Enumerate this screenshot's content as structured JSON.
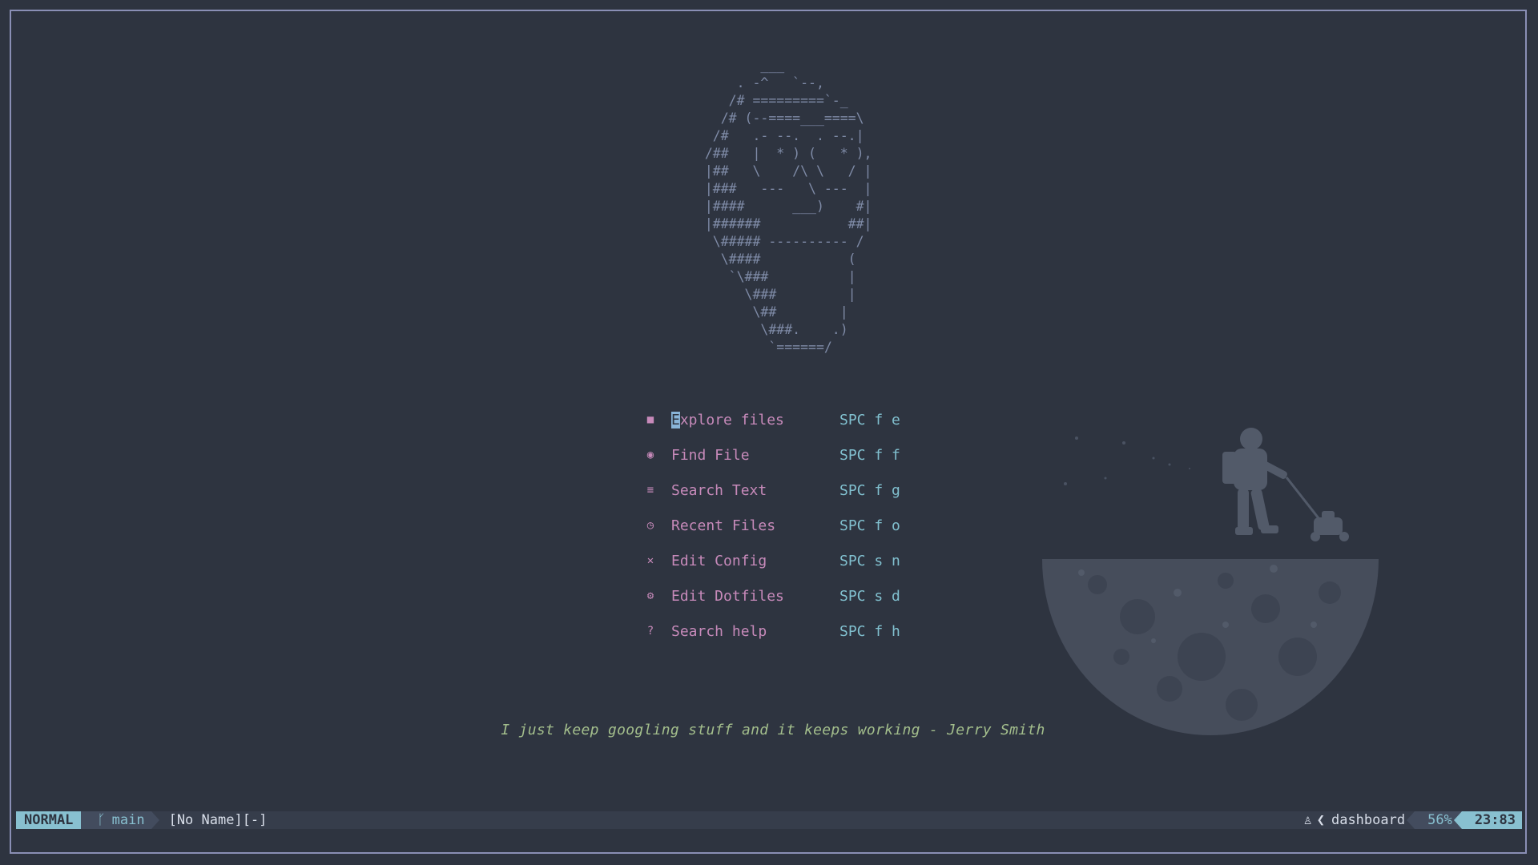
{
  "ascii_art": "         ___\n      . -^   `--,\n     /# =========`-_\n    /# (--====___====\\\n   /#   .- --.  . --.|\n  /##   |  * ) (   * ),\n  |##   \\    /\\ \\   / |\n  |###   ---   \\ ---  |\n  |####      ___)    #|\n  |######           ##|\n   \\##### ---------- /\n    \\####           (\n     `\\###          |\n       \\###         |\n        \\##        |\n         \\###.    .)\n          `======/",
  "menu": [
    {
      "icon": "file-icon",
      "glyph": "■",
      "first": "E",
      "rest": "xplore files",
      "key": "SPC f e"
    },
    {
      "icon": "find-file-icon",
      "glyph": "◉",
      "first": "",
      "rest": "Find File",
      "key": "SPC f f"
    },
    {
      "icon": "search-text-icon",
      "glyph": "≡",
      "first": "",
      "rest": "Search Text",
      "key": "SPC f g"
    },
    {
      "icon": "clock-icon",
      "glyph": "◷",
      "first": "",
      "rest": "Recent Files",
      "key": "SPC f o"
    },
    {
      "icon": "neovim-icon",
      "glyph": "✕",
      "first": "",
      "rest": "Edit Config",
      "key": "SPC s n"
    },
    {
      "icon": "gear-icon",
      "glyph": "⚙",
      "first": "",
      "rest": "Edit Dotfiles",
      "key": "SPC s d"
    },
    {
      "icon": "help-icon",
      "glyph": "?",
      "first": "",
      "rest": "Search help",
      "key": "SPC f h"
    }
  ],
  "quote": "I just keep googling stuff and it keeps working - Jerry Smith",
  "statusline": {
    "mode": "NORMAL",
    "branch": "main",
    "file": "[No Name][-]",
    "filetype": "dashboard",
    "percent": "56%",
    "position": "23:83"
  },
  "colors": {
    "background": "#2e3440",
    "accent": "#88c0d0",
    "menu_label": "#c78aba",
    "quote": "#a3be8c"
  }
}
